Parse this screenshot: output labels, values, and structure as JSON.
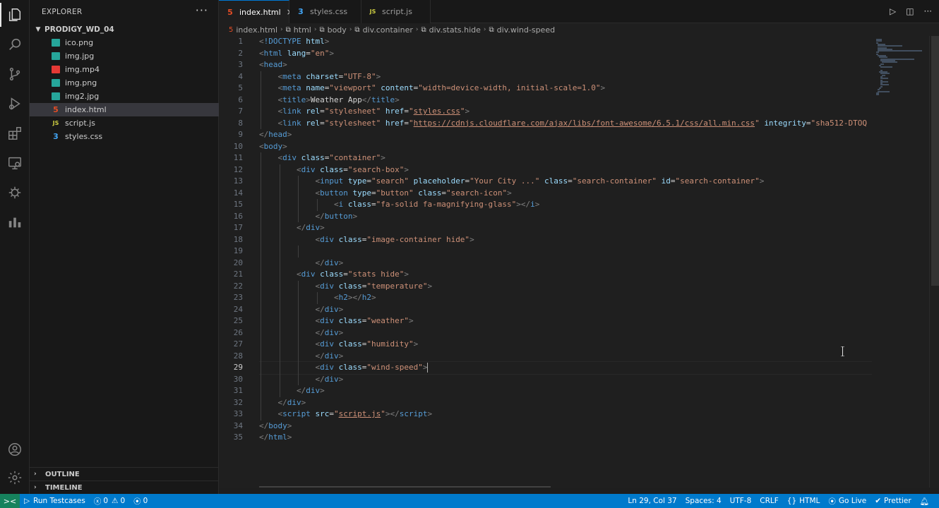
{
  "activity_bar": {
    "icons": [
      "files-icon",
      "search-icon",
      "source-control-icon",
      "run-debug-icon",
      "extensions-icon",
      "remote-explorer-icon",
      "testing-icon",
      "chart-icon"
    ],
    "bottom_icons": [
      "account-icon",
      "settings-gear-icon"
    ]
  },
  "sidebar": {
    "title": "EXPLORER",
    "more": "···",
    "folder": "PRODIGY_WD_04",
    "files": [
      {
        "name": "ico.png",
        "type": "img"
      },
      {
        "name": "img.jpg",
        "type": "img"
      },
      {
        "name": "img.mp4",
        "type": "vid"
      },
      {
        "name": "img.png",
        "type": "img"
      },
      {
        "name": "img2.jpg",
        "type": "img"
      },
      {
        "name": "index.html",
        "type": "html",
        "selected": true
      },
      {
        "name": "script.js",
        "type": "js"
      },
      {
        "name": "styles.css",
        "type": "css"
      }
    ],
    "outline": "OUTLINE",
    "timeline": "TIMELINE"
  },
  "tabs": [
    {
      "label": "index.html",
      "icon": "html-file-icon",
      "active": true,
      "close": "×"
    },
    {
      "label": "styles.css",
      "icon": "css-file-icon",
      "active": false
    },
    {
      "label": "script.js",
      "icon": "js-file-icon",
      "active": false
    }
  ],
  "tab_actions": [
    "run-icon",
    "split-editor-icon",
    "more-actions-icon"
  ],
  "breadcrumb": [
    "index.html",
    "html",
    "body",
    "div.container",
    "div.stats.hide",
    "div.wind-speed"
  ],
  "editor": {
    "current_line": 29,
    "lines": [
      [
        [
          "br",
          "<"
        ],
        [
          "tag",
          "!DOCTYPE"
        ],
        [
          "t",
          " "
        ],
        [
          "attr",
          "html"
        ],
        [
          "br",
          ">"
        ]
      ],
      [
        [
          "br",
          "<"
        ],
        [
          "tag",
          "html"
        ],
        [
          "t",
          " "
        ],
        [
          "attr",
          "lang"
        ],
        [
          "t",
          "="
        ],
        [
          "str",
          "\"en\""
        ],
        [
          "br",
          ">"
        ]
      ],
      [
        [
          "br",
          "<"
        ],
        [
          "tag",
          "head"
        ],
        [
          "br",
          ">"
        ]
      ],
      [
        [
          "t",
          "    "
        ],
        [
          "br",
          "<"
        ],
        [
          "tag",
          "meta"
        ],
        [
          "t",
          " "
        ],
        [
          "attr",
          "charset"
        ],
        [
          "t",
          "="
        ],
        [
          "str",
          "\"UTF-8\""
        ],
        [
          "br",
          ">"
        ]
      ],
      [
        [
          "t",
          "    "
        ],
        [
          "br",
          "<"
        ],
        [
          "tag",
          "meta"
        ],
        [
          "t",
          " "
        ],
        [
          "attr",
          "name"
        ],
        [
          "t",
          "="
        ],
        [
          "str",
          "\"viewport\""
        ],
        [
          "t",
          " "
        ],
        [
          "attr",
          "content"
        ],
        [
          "t",
          "="
        ],
        [
          "str",
          "\"width=device-width, initial-scale=1.0\""
        ],
        [
          "br",
          ">"
        ]
      ],
      [
        [
          "t",
          "    "
        ],
        [
          "br",
          "<"
        ],
        [
          "tag",
          "title"
        ],
        [
          "br",
          ">"
        ],
        [
          "t",
          "Weather App"
        ],
        [
          "br",
          "</"
        ],
        [
          "tag",
          "title"
        ],
        [
          "br",
          ">"
        ]
      ],
      [
        [
          "t",
          "    "
        ],
        [
          "br",
          "<"
        ],
        [
          "tag",
          "link"
        ],
        [
          "t",
          " "
        ],
        [
          "attr",
          "rel"
        ],
        [
          "t",
          "="
        ],
        [
          "str",
          "\"stylesheet\""
        ],
        [
          "t",
          " "
        ],
        [
          "attr",
          "href"
        ],
        [
          "t",
          "="
        ],
        [
          "str",
          "\""
        ],
        [
          "link",
          "styles.css"
        ],
        [
          "str",
          "\""
        ],
        [
          "br",
          ">"
        ]
      ],
      [
        [
          "t",
          "    "
        ],
        [
          "br",
          "<"
        ],
        [
          "tag",
          "link"
        ],
        [
          "t",
          " "
        ],
        [
          "attr",
          "rel"
        ],
        [
          "t",
          "="
        ],
        [
          "str",
          "\"stylesheet\""
        ],
        [
          "t",
          " "
        ],
        [
          "attr",
          "href"
        ],
        [
          "t",
          "="
        ],
        [
          "str",
          "\""
        ],
        [
          "link",
          "https://cdnjs.cloudflare.com/ajax/libs/font-awesome/6.5.1/css/all.min.css"
        ],
        [
          "str",
          "\""
        ],
        [
          "t",
          " "
        ],
        [
          "attr",
          "integrity"
        ],
        [
          "t",
          "="
        ],
        [
          "str",
          "\"sha512-DTOQ"
        ]
      ],
      [
        [
          "br",
          "</"
        ],
        [
          "tag",
          "head"
        ],
        [
          "br",
          ">"
        ]
      ],
      [
        [
          "br",
          "<"
        ],
        [
          "tag",
          "body"
        ],
        [
          "br",
          ">"
        ]
      ],
      [
        [
          "t",
          "    "
        ],
        [
          "br",
          "<"
        ],
        [
          "tag",
          "div"
        ],
        [
          "t",
          " "
        ],
        [
          "attr",
          "class"
        ],
        [
          "t",
          "="
        ],
        [
          "str",
          "\"container\""
        ],
        [
          "br",
          ">"
        ]
      ],
      [
        [
          "t",
          "        "
        ],
        [
          "br",
          "<"
        ],
        [
          "tag",
          "div"
        ],
        [
          "t",
          " "
        ],
        [
          "attr",
          "class"
        ],
        [
          "t",
          "="
        ],
        [
          "str",
          "\"search-box\""
        ],
        [
          "br",
          ">"
        ]
      ],
      [
        [
          "t",
          "            "
        ],
        [
          "br",
          "<"
        ],
        [
          "tag",
          "input"
        ],
        [
          "t",
          " "
        ],
        [
          "attr",
          "type"
        ],
        [
          "t",
          "="
        ],
        [
          "str",
          "\"search\""
        ],
        [
          "t",
          " "
        ],
        [
          "attr",
          "placeholder"
        ],
        [
          "t",
          "="
        ],
        [
          "str",
          "\"Your City ...\""
        ],
        [
          "t",
          " "
        ],
        [
          "attr",
          "class"
        ],
        [
          "t",
          "="
        ],
        [
          "str",
          "\"search-container\""
        ],
        [
          "t",
          " "
        ],
        [
          "attr",
          "id"
        ],
        [
          "t",
          "="
        ],
        [
          "str",
          "\"search-container\""
        ],
        [
          "br",
          ">"
        ]
      ],
      [
        [
          "t",
          "            "
        ],
        [
          "br",
          "<"
        ],
        [
          "tag",
          "button"
        ],
        [
          "t",
          " "
        ],
        [
          "attr",
          "type"
        ],
        [
          "t",
          "="
        ],
        [
          "str",
          "\"button\""
        ],
        [
          "t",
          " "
        ],
        [
          "attr",
          "class"
        ],
        [
          "t",
          "="
        ],
        [
          "str",
          "\"search-icon\""
        ],
        [
          "br",
          ">"
        ]
      ],
      [
        [
          "t",
          "                "
        ],
        [
          "br",
          "<"
        ],
        [
          "tag",
          "i"
        ],
        [
          "t",
          " "
        ],
        [
          "attr",
          "class"
        ],
        [
          "t",
          "="
        ],
        [
          "str",
          "\"fa-solid fa-magnifying-glass\""
        ],
        [
          "br",
          "></"
        ],
        [
          "tag",
          "i"
        ],
        [
          "br",
          ">"
        ]
      ],
      [
        [
          "t",
          "            "
        ],
        [
          "br",
          "</"
        ],
        [
          "tag",
          "button"
        ],
        [
          "br",
          ">"
        ]
      ],
      [
        [
          "t",
          "        "
        ],
        [
          "br",
          "</"
        ],
        [
          "tag",
          "div"
        ],
        [
          "br",
          ">"
        ]
      ],
      [
        [
          "t",
          "            "
        ],
        [
          "br",
          "<"
        ],
        [
          "tag",
          "div"
        ],
        [
          "t",
          " "
        ],
        [
          "attr",
          "class"
        ],
        [
          "t",
          "="
        ],
        [
          "str",
          "\"image-container hide\""
        ],
        [
          "br",
          ">"
        ]
      ],
      [
        [
          "t",
          ""
        ]
      ],
      [
        [
          "t",
          "            "
        ],
        [
          "br",
          "</"
        ],
        [
          "tag",
          "div"
        ],
        [
          "br",
          ">"
        ]
      ],
      [
        [
          "t",
          "        "
        ],
        [
          "br",
          "<"
        ],
        [
          "tag",
          "div"
        ],
        [
          "t",
          " "
        ],
        [
          "attr",
          "class"
        ],
        [
          "t",
          "="
        ],
        [
          "str",
          "\"stats hide\""
        ],
        [
          "br",
          ">"
        ]
      ],
      [
        [
          "t",
          "            "
        ],
        [
          "br",
          "<"
        ],
        [
          "tag",
          "div"
        ],
        [
          "t",
          " "
        ],
        [
          "attr",
          "class"
        ],
        [
          "t",
          "="
        ],
        [
          "str",
          "\"temperature\""
        ],
        [
          "br",
          ">"
        ]
      ],
      [
        [
          "t",
          "                "
        ],
        [
          "br",
          "<"
        ],
        [
          "tag",
          "h2"
        ],
        [
          "br",
          "></"
        ],
        [
          "tag",
          "h2"
        ],
        [
          "br",
          ">"
        ]
      ],
      [
        [
          "t",
          "            "
        ],
        [
          "br",
          "</"
        ],
        [
          "tag",
          "div"
        ],
        [
          "br",
          ">"
        ]
      ],
      [
        [
          "t",
          "            "
        ],
        [
          "br",
          "<"
        ],
        [
          "tag",
          "div"
        ],
        [
          "t",
          " "
        ],
        [
          "attr",
          "class"
        ],
        [
          "t",
          "="
        ],
        [
          "str",
          "\"weather\""
        ],
        [
          "br",
          ">"
        ]
      ],
      [
        [
          "t",
          "            "
        ],
        [
          "br",
          "</"
        ],
        [
          "tag",
          "div"
        ],
        [
          "br",
          ">"
        ]
      ],
      [
        [
          "t",
          "            "
        ],
        [
          "br",
          "<"
        ],
        [
          "tag",
          "div"
        ],
        [
          "t",
          " "
        ],
        [
          "attr",
          "class"
        ],
        [
          "t",
          "="
        ],
        [
          "str",
          "\"humidity\""
        ],
        [
          "br",
          ">"
        ]
      ],
      [
        [
          "t",
          "            "
        ],
        [
          "br",
          "</"
        ],
        [
          "tag",
          "div"
        ],
        [
          "br",
          ">"
        ]
      ],
      [
        [
          "t",
          "            "
        ],
        [
          "br",
          "<"
        ],
        [
          "tag",
          "div"
        ],
        [
          "t",
          " "
        ],
        [
          "attr",
          "class"
        ],
        [
          "t",
          "="
        ],
        [
          "str",
          "\"wind-speed\""
        ],
        [
          "br",
          ">"
        ],
        [
          "cursor",
          ""
        ]
      ],
      [
        [
          "t",
          "            "
        ],
        [
          "br",
          "</"
        ],
        [
          "tag",
          "div"
        ],
        [
          "br",
          ">"
        ]
      ],
      [
        [
          "t",
          "        "
        ],
        [
          "br",
          "</"
        ],
        [
          "tag",
          "div"
        ],
        [
          "br",
          ">"
        ]
      ],
      [
        [
          "t",
          "    "
        ],
        [
          "br",
          "</"
        ],
        [
          "tag",
          "div"
        ],
        [
          "br",
          ">"
        ]
      ],
      [
        [
          "t",
          "    "
        ],
        [
          "br",
          "<"
        ],
        [
          "tag",
          "script"
        ],
        [
          "t",
          " "
        ],
        [
          "attr",
          "src"
        ],
        [
          "t",
          "="
        ],
        [
          "str",
          "\""
        ],
        [
          "link",
          "script.js"
        ],
        [
          "str",
          "\""
        ],
        [
          "br",
          "></"
        ],
        [
          "tag",
          "script"
        ],
        [
          "br",
          ">"
        ]
      ],
      [
        [
          "br",
          "</"
        ],
        [
          "tag",
          "body"
        ],
        [
          "br",
          ">"
        ]
      ],
      [
        [
          "br",
          "</"
        ],
        [
          "tag",
          "html"
        ],
        [
          "br",
          ">"
        ]
      ]
    ]
  },
  "status_bar": {
    "remote": "><",
    "run_testcases": "Run Testcases",
    "errors": "0",
    "warnings": "0",
    "ports": "0",
    "cursor_pos": "Ln 29, Col 37",
    "spaces": "Spaces: 4",
    "encoding": "UTF-8",
    "eol": "CRLF",
    "language": "HTML",
    "go_live": "Go Live",
    "prettier": "Prettier"
  }
}
